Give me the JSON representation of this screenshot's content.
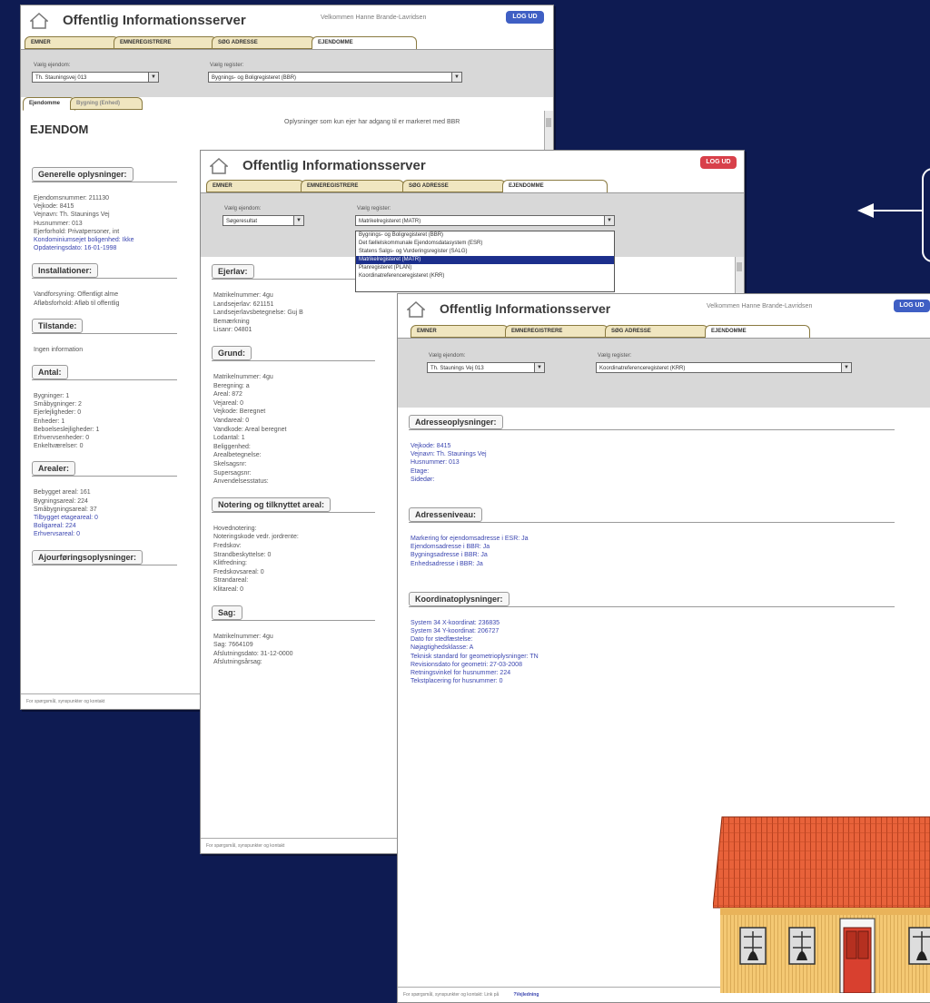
{
  "windows": [
    {
      "title": "Offentlig Informationsserver",
      "welcome": "Velkommen Hanne Brande-Lavridsen",
      "logout": "LOG UD",
      "tabs": [
        "EMNER",
        "EMNEREGISTRERE",
        "SØG ADRESSE",
        "EJENDOMME"
      ],
      "select_label_1": "Vælg ejendom:",
      "select_value_1": "Th. Stauningsvej 013",
      "select_label_2": "Vælg register:",
      "select_value_2": "Bygnings- og Boligregisteret (BBR)",
      "subtabs": [
        "Ejendomme",
        "Bygning (Enhed)"
      ],
      "heading": "EJENDOM",
      "note": "Oplysninger som kun ejer har adgang til er markeret med BBR",
      "sections": [
        {
          "title": "Generelle oplysninger:",
          "lines": [
            {
              "t": "Ejendomsnummer: 211130",
              "blue": false
            },
            {
              "t": "Vejkode: 8415",
              "blue": false
            },
            {
              "t": "Vejnavn: Th. Staunings Vej",
              "blue": false
            },
            {
              "t": "Husnummer: 013",
              "blue": false
            },
            {
              "t": "Ejerforhold: Privatpersoner, int",
              "blue": false
            },
            {
              "t": "Kondominiumsejet boligenhed: Ikke",
              "blue": true
            },
            {
              "t": "Opdateringsdato: 16-01-1998",
              "blue": true
            }
          ]
        },
        {
          "title": "Installationer:",
          "lines": [
            {
              "t": "Vandforsyning: Offentligt alme",
              "blue": false
            },
            {
              "t": "Afløbsforhold: Afløb til offentlig",
              "blue": false
            }
          ]
        },
        {
          "title": "Tilstande:",
          "lines": [
            {
              "t": "Ingen information",
              "blue": false
            }
          ]
        },
        {
          "title": "Antal:",
          "lines": [
            {
              "t": "Bygninger: 1",
              "blue": false
            },
            {
              "t": "Småbygninger: 2",
              "blue": false
            },
            {
              "t": "Ejerlejligheder: 0",
              "blue": false
            },
            {
              "t": "Enheder: 1",
              "blue": false
            },
            {
              "t": "Beboelseslejligheder: 1",
              "blue": false
            },
            {
              "t": "Erhvervsenheder: 0",
              "blue": false
            },
            {
              "t": "Enkeltværelser: 0",
              "blue": false
            }
          ]
        },
        {
          "title": "Arealer:",
          "lines": [
            {
              "t": "Bebygget areal: 161",
              "blue": false
            },
            {
              "t": "Bygningsareal: 224",
              "blue": false
            },
            {
              "t": "Småbygningsareal: 37",
              "blue": false
            },
            {
              "t": "Tilbygget etageareal: 0",
              "blue": true
            },
            {
              "t": "Boligareal: 224",
              "blue": true
            },
            {
              "t": "Erhvervsareal: 0",
              "blue": true
            }
          ]
        },
        {
          "title": "Ajourføringsoplysninger:",
          "lines": []
        }
      ],
      "footer": "For spørgsmål, synspunkter og kontakt"
    },
    {
      "title": "Offentlig Informationsserver",
      "logout": "LOG UD",
      "tabs": [
        "EMNER",
        "EMNEREGISTRERE",
        "SØG ADRESSE",
        "EJENDOMME"
      ],
      "select_label_1": "Vælg ejendom:",
      "select_value_1": "Søgeresultat",
      "select_label_2": "Vælg register:",
      "select_value_2": "Matrikelregisteret (MATR)",
      "dropdown": [
        "Bygnings- og Boligregisteret (BBR)",
        "Det fællelskommunale Ejendomsdatasystem (ESR)",
        "Statens Salgs- og Vurderingsregister (SALG)",
        "Matrikelregisteret (MATR)",
        "Planregisteret (PLAN)",
        "Koordinatreferenceregisteret (KRR)"
      ],
      "dropdown_selected": 3,
      "sections": [
        {
          "title": "Ejerlav:",
          "lines": [
            {
              "t": "Matrikelnummer: 4gu",
              "blue": false
            },
            {
              "t": "Landsejerlav: 621151",
              "blue": false
            },
            {
              "t": "Landsejerlavsbetegnelse: Guj B",
              "blue": false
            },
            {
              "t": "Bemærkning",
              "blue": false
            },
            {
              "t": "Lisanr: 04801",
              "blue": false
            }
          ]
        },
        {
          "title": "Grund:",
          "lines": [
            {
              "t": "Matrikelnummer: 4gu",
              "blue": false
            },
            {
              "t": "Beregning: a",
              "blue": false
            },
            {
              "t": "Areal: 872",
              "blue": false
            },
            {
              "t": "Vejareal: 0",
              "blue": false
            },
            {
              "t": "Vejkode: Beregnet",
              "blue": false
            },
            {
              "t": "Vandareal: 0",
              "blue": false
            },
            {
              "t": "Vandkode: Areal beregnet",
              "blue": false
            },
            {
              "t": "Lodantal: 1",
              "blue": false
            },
            {
              "t": "Beliggenhed:",
              "blue": false
            },
            {
              "t": "Arealbetegnelse:",
              "blue": false
            },
            {
              "t": "Skelsagsnr:",
              "blue": false
            },
            {
              "t": "Supersagsnr:",
              "blue": false
            },
            {
              "t": "Anvendelsesstatus:",
              "blue": false
            }
          ]
        },
        {
          "title": "Notering og tilknyttet areal:",
          "lines": [
            {
              "t": "Hovednotering:",
              "blue": false
            },
            {
              "t": "Noteringskode vedr. jordrente:",
              "blue": false
            },
            {
              "t": "Fredskov:",
              "blue": false
            },
            {
              "t": "Strandbeskyttelse: 0",
              "blue": false
            },
            {
              "t": "Klitfredning:",
              "blue": false
            },
            {
              "t": "Fredskovsareal: 0",
              "blue": false
            },
            {
              "t": "Strandareal:",
              "blue": false
            },
            {
              "t": "Klitareal: 0",
              "blue": false
            }
          ]
        },
        {
          "title": "Sag:",
          "lines": [
            {
              "t": "Matrikelnummer: 4gu",
              "blue": false
            },
            {
              "t": "Sag: 7664109",
              "blue": false
            },
            {
              "t": "Afslutningsdato: 31-12-0000",
              "blue": false
            },
            {
              "t": "Afslutningsårsag:",
              "blue": false
            }
          ]
        }
      ],
      "footer": "For spørgsmål, synspunkter og kontakt"
    },
    {
      "title": "Offentlig Informationsserver",
      "welcome": "Velkommen Hanne Brande-Lavridsen",
      "logout": "LOG UD",
      "tabs": [
        "EMNER",
        "EMNEREGISTRERE",
        "SØG ADRESSE",
        "EJENDOMME"
      ],
      "select_label_1": "Vælg ejendom:",
      "select_value_1": "Th. Staunings Vej 013",
      "select_label_2": "Vælg register:",
      "select_value_2": "Koordinatreferenceregisteret (KRR)",
      "sections": [
        {
          "title": "Adresseoplysninger:",
          "lines": [
            {
              "t": "Vejkode: 8415",
              "blue": true
            },
            {
              "t": "Vejnavn: Th. Staunings Vej",
              "blue": true
            },
            {
              "t": "Husnummer: 013",
              "blue": true
            },
            {
              "t": "Etage:",
              "blue": true
            },
            {
              "t": "Sidedør:",
              "blue": true
            }
          ]
        },
        {
          "title": "Adresseniveau:",
          "lines": [
            {
              "t": "Markering for ejendomsadresse i ESR: Ja",
              "blue": true
            },
            {
              "t": "Ejendomsadresse i BBR: Ja",
              "blue": true
            },
            {
              "t": "Bygningsadresse i BBR: Ja",
              "blue": true
            },
            {
              "t": "Enhedsadresse i BBR: Ja",
              "blue": true
            }
          ]
        },
        {
          "title": "Koordinatoplysninger:",
          "lines": [
            {
              "t": "System 34 X-koordinat: 236835",
              "blue": true
            },
            {
              "t": "System 34 Y-koordinat: 206727",
              "blue": true
            },
            {
              "t": "Dato for stedfæstelse:",
              "blue": true
            },
            {
              "t": "Nøjagtighedsklasse: A",
              "blue": true
            },
            {
              "t": "Teknisk standard for geometrioplysninger: TN",
              "blue": true
            },
            {
              "t": "Revisionsdato for geometri: 27-03-2008",
              "blue": true
            },
            {
              "t": "Retningsvinkel for husnummer: 224",
              "blue": true
            },
            {
              "t": "Tekstplacering for husnummer: 0",
              "blue": true
            }
          ]
        }
      ],
      "footer": "For spørgsmål, synspunkter og kontakt: Link på",
      "help": "?Vejledning"
    }
  ],
  "colors": {
    "background": "#0e1b52",
    "logout_blue": "#3f5fc4",
    "logout_red": "#d8404a",
    "link_blue": "#3b46b0",
    "dropdown_highlight": "#1c2f8c"
  }
}
